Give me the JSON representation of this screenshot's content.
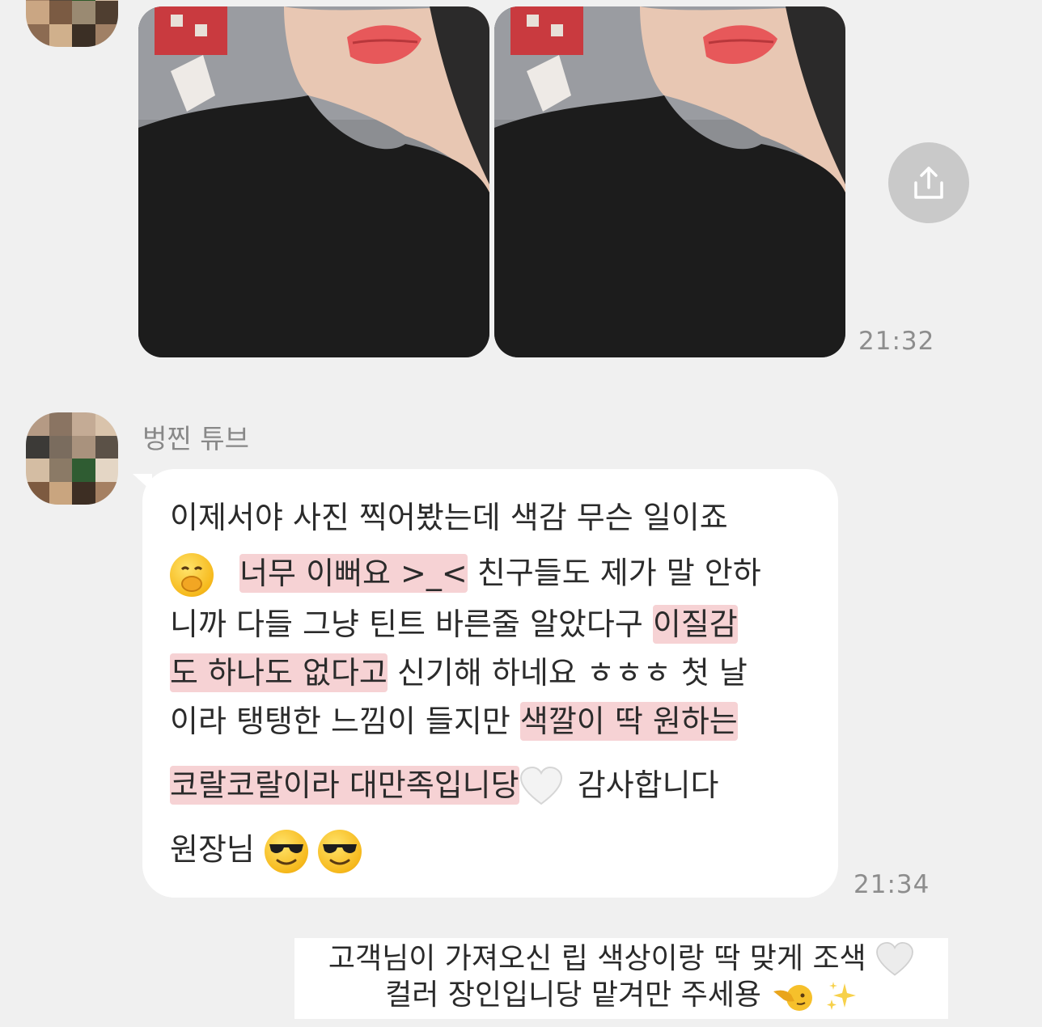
{
  "messages": {
    "photos": {
      "time": "21:32"
    },
    "text": {
      "sender": "벙찐 튜브",
      "time": "21:34",
      "line1": "이제서야 사진 찍어봤는데 색감 무슨 일이죠",
      "line2_hl": "너무 이뻐요 >_<",
      "line2_rest": " 친구들도 제가 말 안하",
      "line3_plain": "니까 다들 그냥 틴트 바른줄 알았다구 ",
      "line3_hl": "이질감",
      "line4_hl": "도 하나도 없다고",
      "line4_rest": " 신기해 하네요 ㅎㅎㅎ 첫 날",
      "line5_plain": "이라 탱탱한 느낌이 들지만 ",
      "line5_hl": "색깔이 딱 원하는",
      "line6_hl": "코랄코랄이라 대만족입니당",
      "line6_rest": " 감사합니다",
      "line7": "원장님"
    }
  },
  "caption": {
    "line1": "고객님이 가져오신 립 색상이랑 딱 맞게 조색",
    "line2": "컬러 장인입니당 맡겨만 주세용"
  },
  "icons": {
    "share": "share-icon",
    "emoji_1": "face-with-hand-over-mouth-emoji",
    "emoji_2": "white-heart-emoji",
    "emoji_3": "sunglasses-face-emoji",
    "emoji_4": "pointing-face-emoji",
    "emoji_5": "sparkles-emoji"
  },
  "colors": {
    "background": "#f0f0f0",
    "bubble": "#ffffff",
    "highlight": "#f6d2d4",
    "share_button": "#c9c9c9"
  }
}
